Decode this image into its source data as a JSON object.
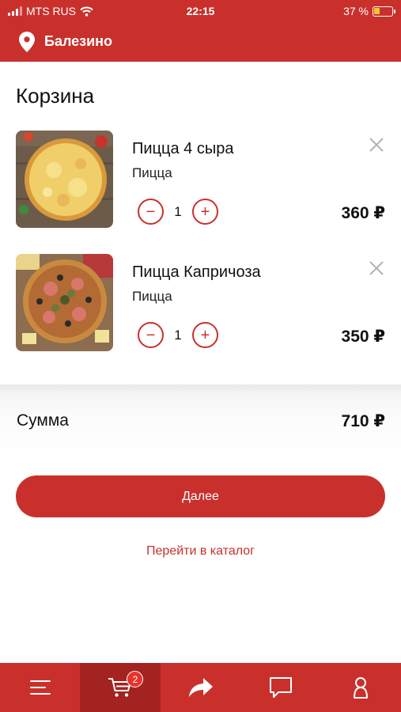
{
  "status_bar": {
    "carrier": "MTS RUS",
    "time": "22:15",
    "battery": "37 %",
    "battery_level": 0.37
  },
  "header": {
    "city": "Балезино",
    "icon": "location-pin-icon"
  },
  "page": {
    "title": "Корзина"
  },
  "cart": {
    "items": [
      {
        "name": "Пицца 4 сыра",
        "category": "Пицца",
        "quantity": "1",
        "price": "360 ₽",
        "image": "four-cheese-pizza"
      },
      {
        "name": "Пицца Капричоза",
        "category": "Пицца",
        "quantity": "1",
        "price": "350 ₽",
        "image": "capricciosa-pizza"
      }
    ],
    "minus_label": "−",
    "plus_label": "+"
  },
  "summary": {
    "label": "Сумма",
    "total": "710 ₽"
  },
  "actions": {
    "next_label": "Далее",
    "catalog_link": "Перейти в каталог"
  },
  "tabbar": {
    "active": "cart",
    "cart_badge": "2",
    "tabs": [
      "menu-icon",
      "cart-icon",
      "share-icon",
      "chat-icon",
      "profile-icon"
    ]
  },
  "colors": {
    "brand": "#c9302c",
    "brand_dark": "#a32320",
    "text": "#111111"
  }
}
